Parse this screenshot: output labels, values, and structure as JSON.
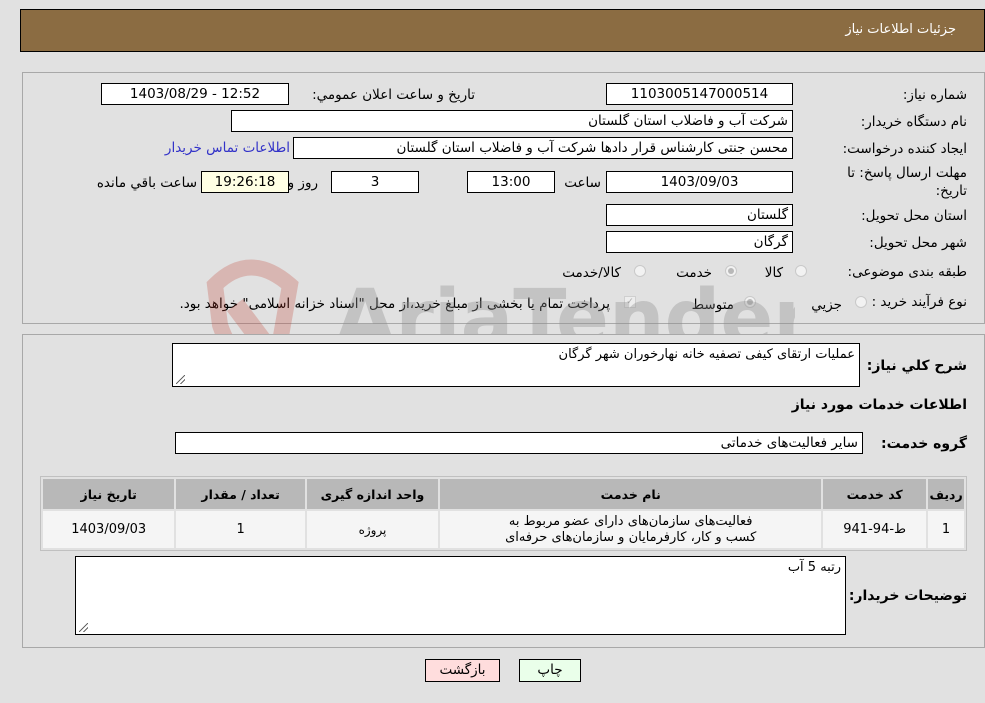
{
  "header": {
    "title": "جزئیات اطلاعات نیاز"
  },
  "colors": {
    "header_bg": "#8b6c42",
    "link": "#3232c8",
    "remaining_bg": "#ffffe4",
    "print_bg": "#eaffea",
    "back_bg": "#ffdddd"
  },
  "details": {
    "need_number_label": "شماره نیاز:",
    "need_number": "1103005147000514",
    "announce_label": "تاریخ و ساعت اعلان عمومي:",
    "announce_value": "1403/08/29 - 12:52",
    "buyer_org_label": "نام دستگاه خریدار:",
    "buyer_org": "شرکت آب و فاضلاب استان گلستان",
    "creator_label": "ایجاد کننده درخواست:",
    "creator": "محسن جنتی کارشناس قرار دادها شرکت آب و فاضلاب استان گلستان",
    "contact_link": "اطلاعات تماس خریدار",
    "deadline_label": "مهلت ارسال پاسخ: تا تاریخ:",
    "deadline_date": "1403/09/03",
    "time_label": "ساعت",
    "deadline_time": "13:00",
    "days": "3",
    "days_label": "روز و",
    "remaining_time": "19:26:18",
    "remaining_label": "ساعت باقي مانده",
    "province_label": "استان محل تحویل:",
    "province": "گلستان",
    "city_label": "شهر محل تحویل:",
    "city": "گرگان",
    "category_label": "طبقه بندی موضوعی:",
    "category_options": [
      {
        "label": "کالا",
        "selected": false
      },
      {
        "label": "خدمت",
        "selected": true
      },
      {
        "label": "کالا/خدمت",
        "selected": false
      }
    ],
    "process_label": "نوع فرآیند خرید :",
    "process_options": [
      {
        "label": "جزيي",
        "selected": false
      },
      {
        "label": "متوسط",
        "selected": true
      }
    ],
    "treasury_checked": true,
    "treasury_text": "پرداخت تمام یا بخشی از مبلغ خرید،از محل \"اسناد خزانه اسلامی\" خواهد بود."
  },
  "description": {
    "label": "شرح کلي نیاز:",
    "value": "عملیات ارتقای کیفی تصفیه خانه نهارخوران شهر گرگان",
    "services_heading": "اطلاعات خدمات مورد نیاز",
    "service_group_label": "گروه خدمت:",
    "service_group": "سایر فعالیت‌های خدماتی"
  },
  "table": {
    "headers": [
      "ردیف",
      "کد خدمت",
      "نام خدمت",
      "واحد اندازه گیری",
      "تعداد / مقدار",
      "تاریخ نیاز"
    ],
    "rows": [
      [
        "1",
        "ط-94-941",
        "فعالیت‌های سازمان‌های دارای عضو مربوط به کسب و کار، کارفرمایان و سازمان‌های حرفه‌ای",
        "پروژه",
        "1",
        "1403/09/03"
      ]
    ]
  },
  "buyer_notes": {
    "label": "توضیحات خریدار:",
    "value": "رتبه 5 آب"
  },
  "actions": {
    "print": "چاپ",
    "back": "بازگشت"
  },
  "watermark": {
    "text": "AriaTender.neT"
  }
}
